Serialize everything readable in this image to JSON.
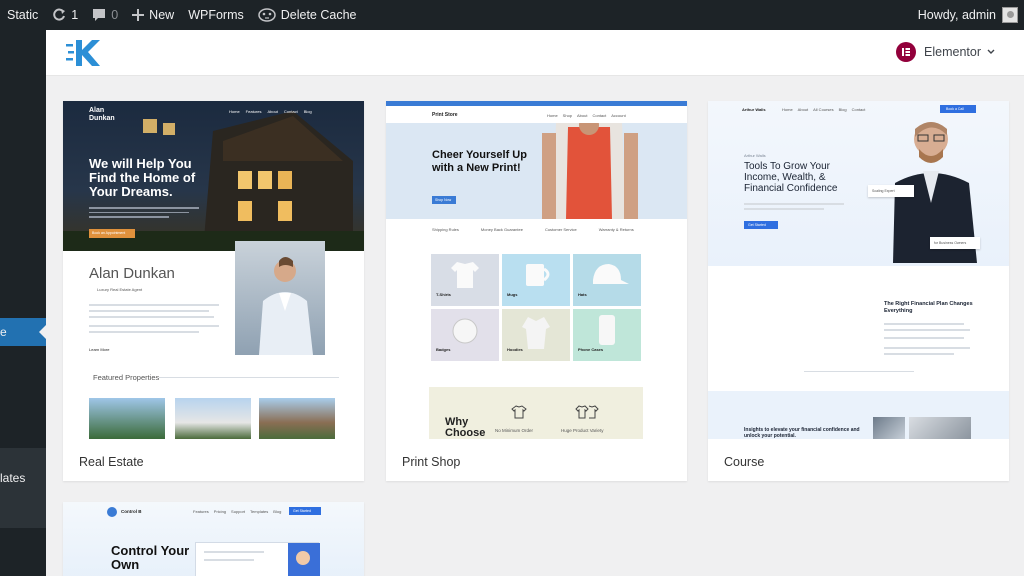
{
  "adminbar": {
    "site_label": "Static",
    "updates_count": "1",
    "comments_count": "0",
    "new_label": "New",
    "wpforms_label": "WPForms",
    "delete_cache_label": "Delete Cache",
    "greeting": "Howdy, admin"
  },
  "sidebar": {
    "active_label": "e",
    "templates_label": "lates"
  },
  "header": {
    "elementor_label": "Elementor"
  },
  "templates": [
    {
      "title": "Real Estate",
      "brand": "Alan Dunkan",
      "nav": [
        "Home",
        "Features",
        "About",
        "Contact",
        "Blog"
      ],
      "hero_title": "We will Help You Find the Home of Your Dreams.",
      "button": "Book an Appointment",
      "agent_name": "Alan Dunkan",
      "agent_role": "Luxury Real Estate Agent",
      "read_more": "Learn More",
      "featured_heading": "Featured Properties"
    },
    {
      "title": "Print Shop",
      "brand": "Print Store",
      "nav": [
        "Home",
        "Shop",
        "About",
        "Contact",
        "Account"
      ],
      "hero_title": "Cheer Yourself Up with a New Print!",
      "hero_button": "Shop Now",
      "features": [
        "Shipping Rules",
        "Money Back Guarantee",
        "Customer Service",
        "Warranty & Returns"
      ],
      "categories": [
        "T-Shirts",
        "Mugs",
        "Hats",
        "Badges",
        "Hoodies",
        "Phone Cases"
      ],
      "why_choose": "Why Choose",
      "why_items": [
        "No Minimum Order",
        "Huge Product Variety"
      ]
    },
    {
      "title": "Course",
      "brand": "Arthur Walls",
      "nav": [
        "Home",
        "About",
        "All Courses",
        "Blog",
        "Contact"
      ],
      "nav_button": "Book a Call",
      "eyebrow": "Arthur Walls",
      "hero_title": "Tools To Grow Your Income, Wealth, & Financial Confidence",
      "hero_button": "Get Started",
      "badge_1": "Scaling Expert",
      "badge_2": "for Business Owners",
      "section_title": "The Right Financial Plan Changes Everything",
      "insights": "Insights to elevate your financial confidence and unlock your potential."
    },
    {
      "title": "",
      "brand": "Control B",
      "nav": [
        "Features",
        "Pricing",
        "Support",
        "Templates",
        "Blog"
      ],
      "nav_button": "Get Started",
      "hero_title": "Control Your Own"
    }
  ]
}
